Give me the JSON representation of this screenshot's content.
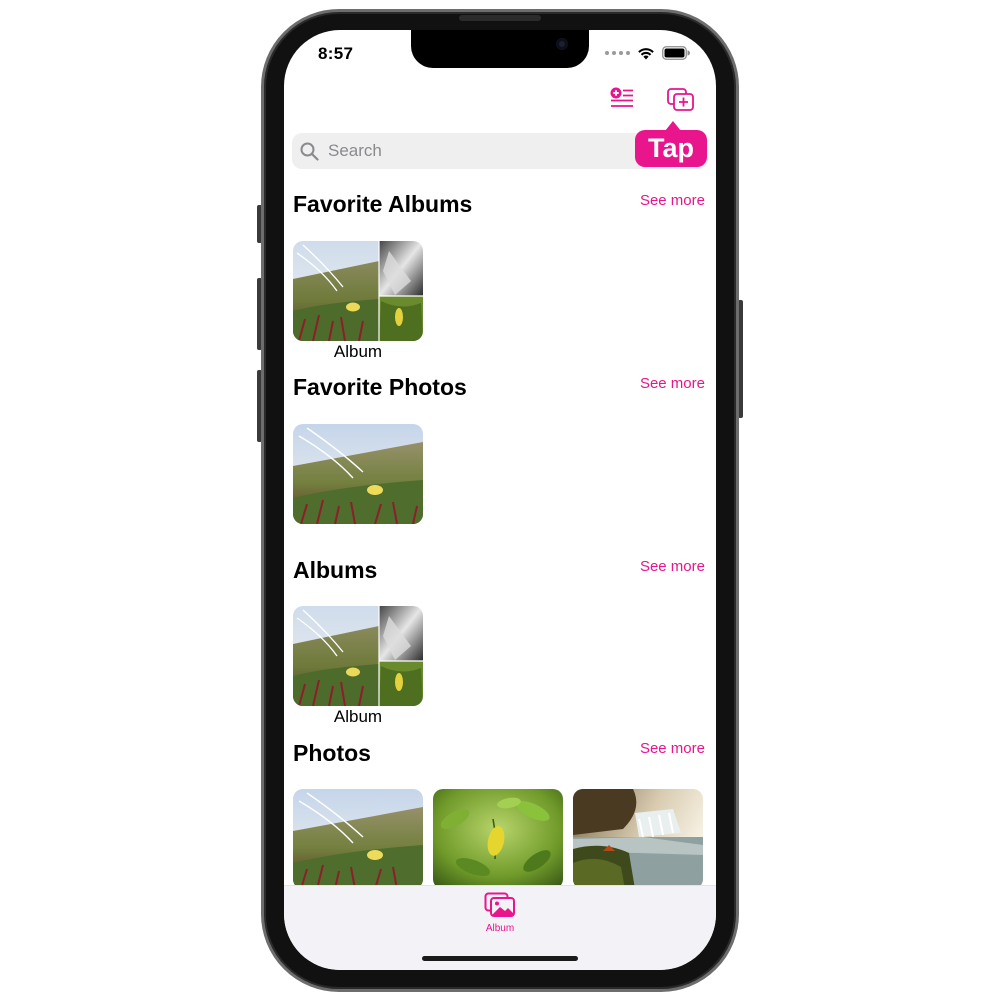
{
  "status_bar": {
    "time": "8:57"
  },
  "nav_bar": {
    "tap_hint": "Tap"
  },
  "search": {
    "placeholder": "Search"
  },
  "sections": [
    {
      "title": "Favorite Albums",
      "see_more": "See more",
      "items": [
        {
          "label": "Album"
        }
      ]
    },
    {
      "title": "Favorite Photos",
      "see_more": "See more"
    },
    {
      "title": "Albums",
      "see_more": "See more",
      "items": [
        {
          "label": "Album"
        }
      ]
    },
    {
      "title": "Photos",
      "see_more": "See more"
    }
  ],
  "tab_bar": {
    "items": [
      {
        "label": "Album",
        "icon": "photo-album-icon",
        "active": true
      }
    ]
  },
  "colors": {
    "accent": "#e8158c",
    "tab_bar_bg": "#f3f2f7",
    "search_bg": "#efeff0"
  }
}
